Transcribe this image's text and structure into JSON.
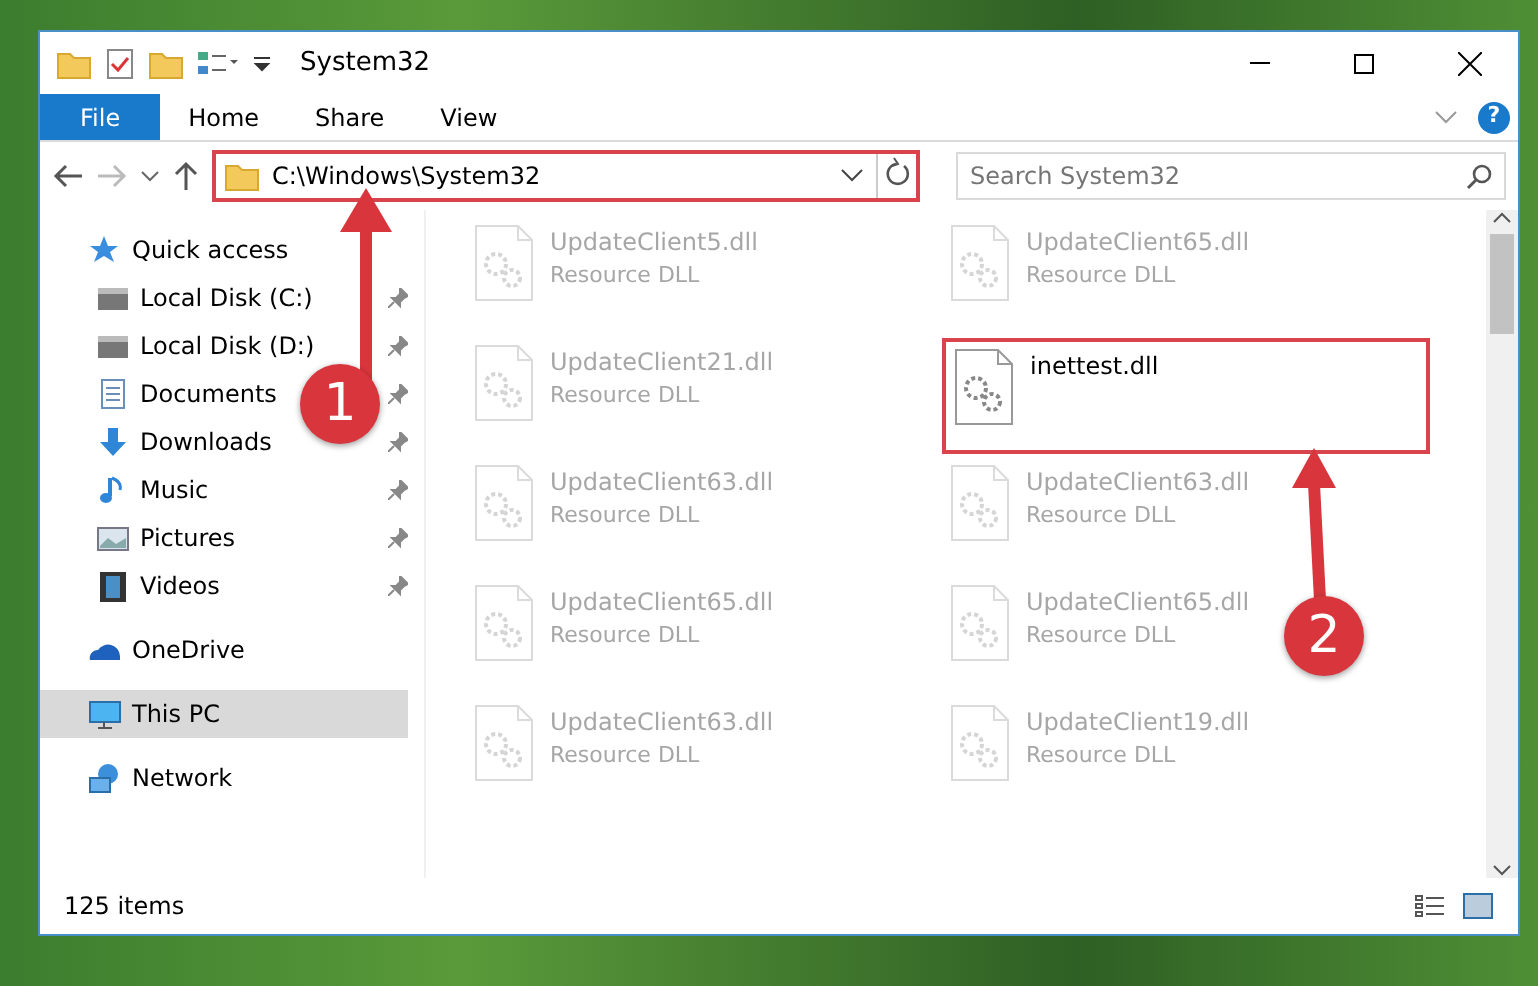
{
  "window": {
    "title": "System32"
  },
  "ribbon_tabs": [
    {
      "label": "File",
      "selected": true
    },
    {
      "label": "Home",
      "selected": false
    },
    {
      "label": "Share",
      "selected": false
    },
    {
      "label": "View",
      "selected": false
    }
  ],
  "help_label": "?",
  "address": {
    "value": "C:\\Windows\\System32",
    "highlighted": true
  },
  "search": {
    "placeholder": "Search System32"
  },
  "nav": [
    {
      "label": "Quick access",
      "kind": "star",
      "selected": false,
      "children": [
        {
          "label": "Local Disk (C:)",
          "kind": "drive",
          "pinned": true,
          "selected": false
        },
        {
          "label": "Local Disk (D:)",
          "kind": "drive",
          "pinned": true,
          "selected": false
        },
        {
          "label": "Documents",
          "kind": "documents",
          "pinned": true,
          "selected": false
        },
        {
          "label": "Downloads",
          "kind": "downloads",
          "pinned": true,
          "selected": false
        },
        {
          "label": "Music",
          "kind": "music",
          "pinned": true,
          "selected": false
        },
        {
          "label": "Pictures",
          "kind": "pictures",
          "pinned": true,
          "selected": false
        },
        {
          "label": "Videos",
          "kind": "videos",
          "pinned": true,
          "selected": false
        }
      ]
    },
    {
      "label": "OneDrive",
      "kind": "cloud",
      "selected": false
    },
    {
      "label": "This PC",
      "kind": "pc",
      "selected": true
    },
    {
      "label": "Network",
      "kind": "network",
      "selected": false
    }
  ],
  "files": [
    {
      "name": "UpdateClient5.dll",
      "type": "Resource DLL",
      "blurred": true,
      "highlighted": false
    },
    {
      "name": "UpdateClient65.dll",
      "type": "Resource DLL",
      "blurred": true,
      "highlighted": false
    },
    {
      "name": "UpdateClient21.dll",
      "type": "Resource DLL",
      "blurred": true,
      "highlighted": false
    },
    {
      "name": "inettest.dll",
      "blurred": false,
      "highlighted": true
    },
    {
      "name": "UpdateClient63.dll",
      "type": "Resource DLL",
      "blurred": true,
      "highlighted": false
    },
    {
      "name": "UpdateClient63.dll",
      "type": "Resource DLL",
      "blurred": true,
      "highlighted": false
    },
    {
      "name": "UpdateClient65.dll",
      "type": "Resource DLL",
      "blurred": true,
      "highlighted": false
    },
    {
      "name": "UpdateClient65.dll",
      "type": "Resource DLL",
      "blurred": true,
      "highlighted": false
    },
    {
      "name": "UpdateClient63.dll",
      "type": "Resource DLL",
      "blurred": true,
      "highlighted": false
    },
    {
      "name": "UpdateClient19.dll",
      "type": "Resource DLL",
      "blurred": true,
      "highlighted": false
    }
  ],
  "status_bar": {
    "item_count": "125 items"
  },
  "callouts": [
    {
      "number": "1"
    },
    {
      "number": "2"
    }
  ]
}
